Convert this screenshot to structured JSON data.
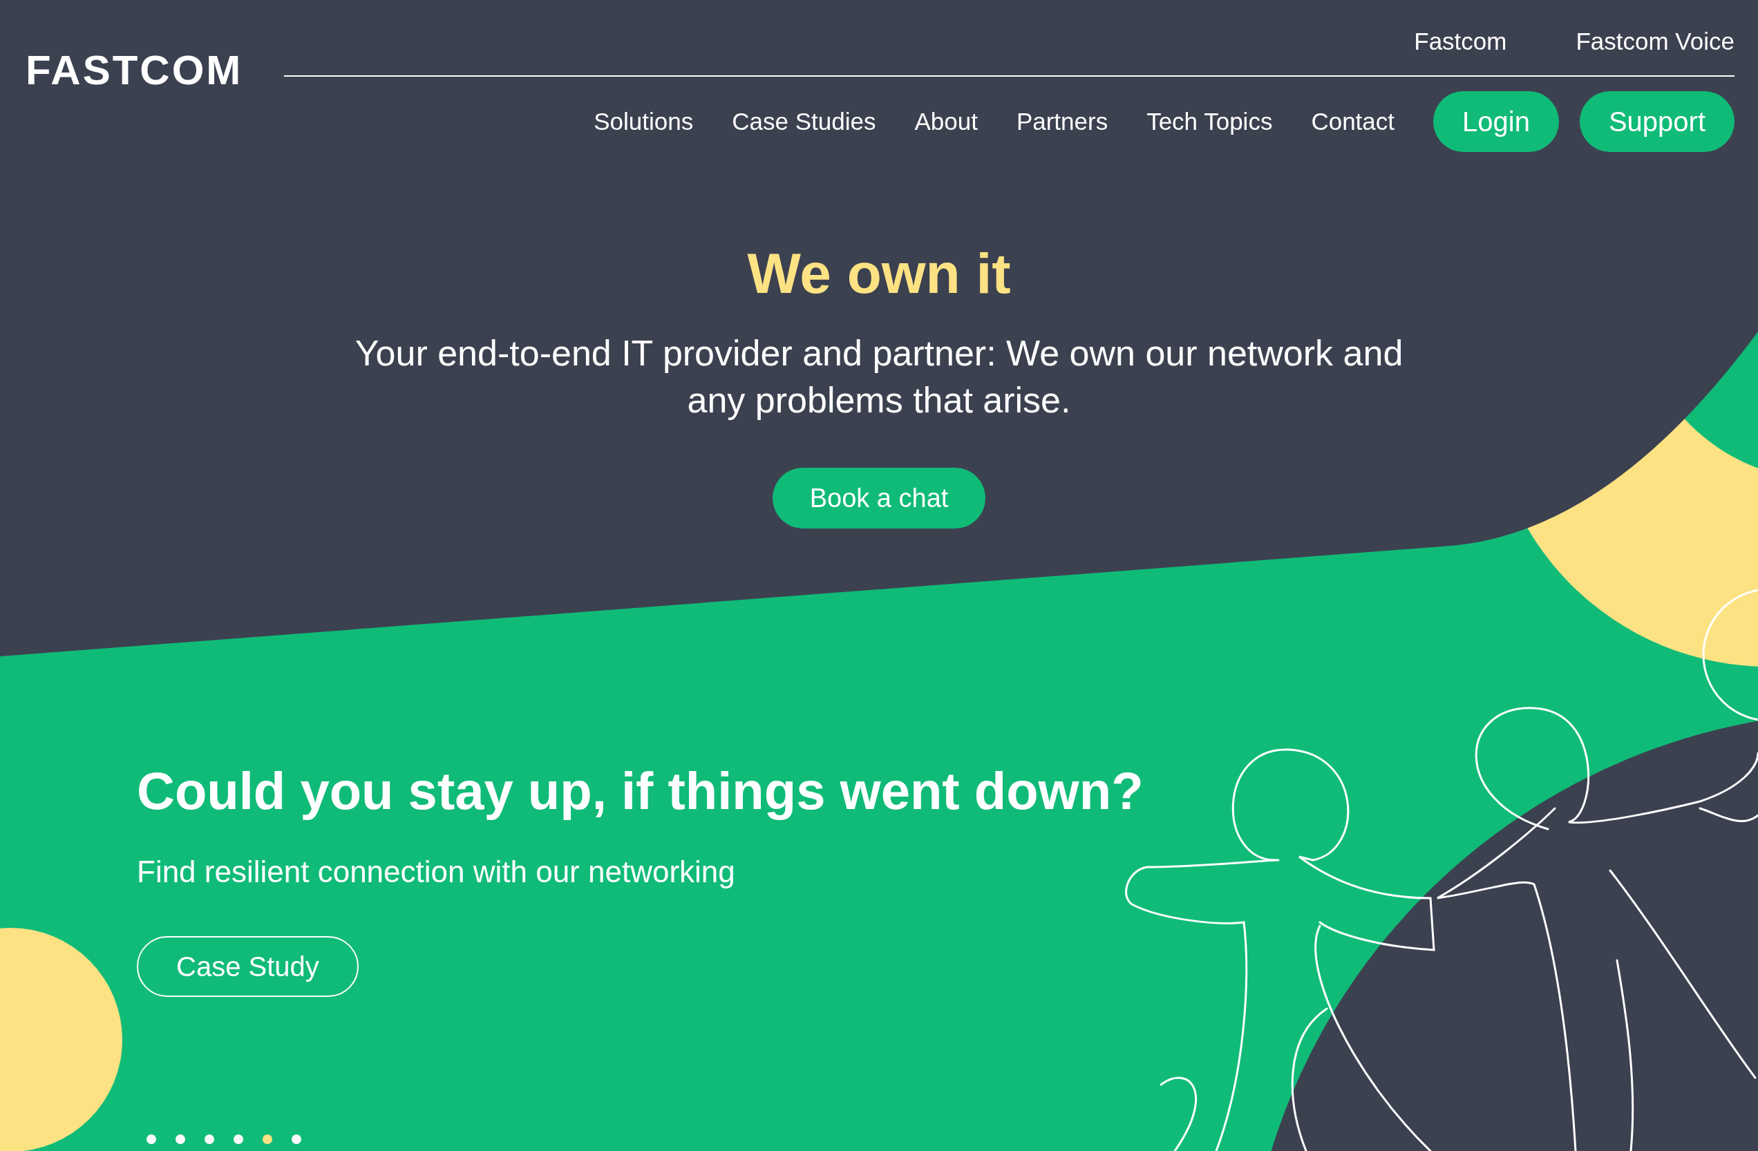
{
  "logo": "FASTCOM",
  "top_links": [
    "Fastcom",
    "Fastcom Voice"
  ],
  "nav": [
    "Solutions",
    "Case Studies",
    "About",
    "Partners",
    "Tech Topics",
    "Contact"
  ],
  "nav_buttons": [
    "Login",
    "Support"
  ],
  "hero": {
    "title": "We own it",
    "subtitle": "Your end-to-end IT provider and partner: We own our network and any problems that arise.",
    "button": "Book a chat"
  },
  "slide": {
    "title": "Could you stay up, if things went down?",
    "text": "Find resilient connection with our networking",
    "button": "Case Study"
  },
  "slide_dots": [
    {
      "selected": false
    },
    {
      "selected": false
    },
    {
      "selected": false
    },
    {
      "selected": false
    },
    {
      "selected": true
    },
    {
      "selected": false
    }
  ]
}
